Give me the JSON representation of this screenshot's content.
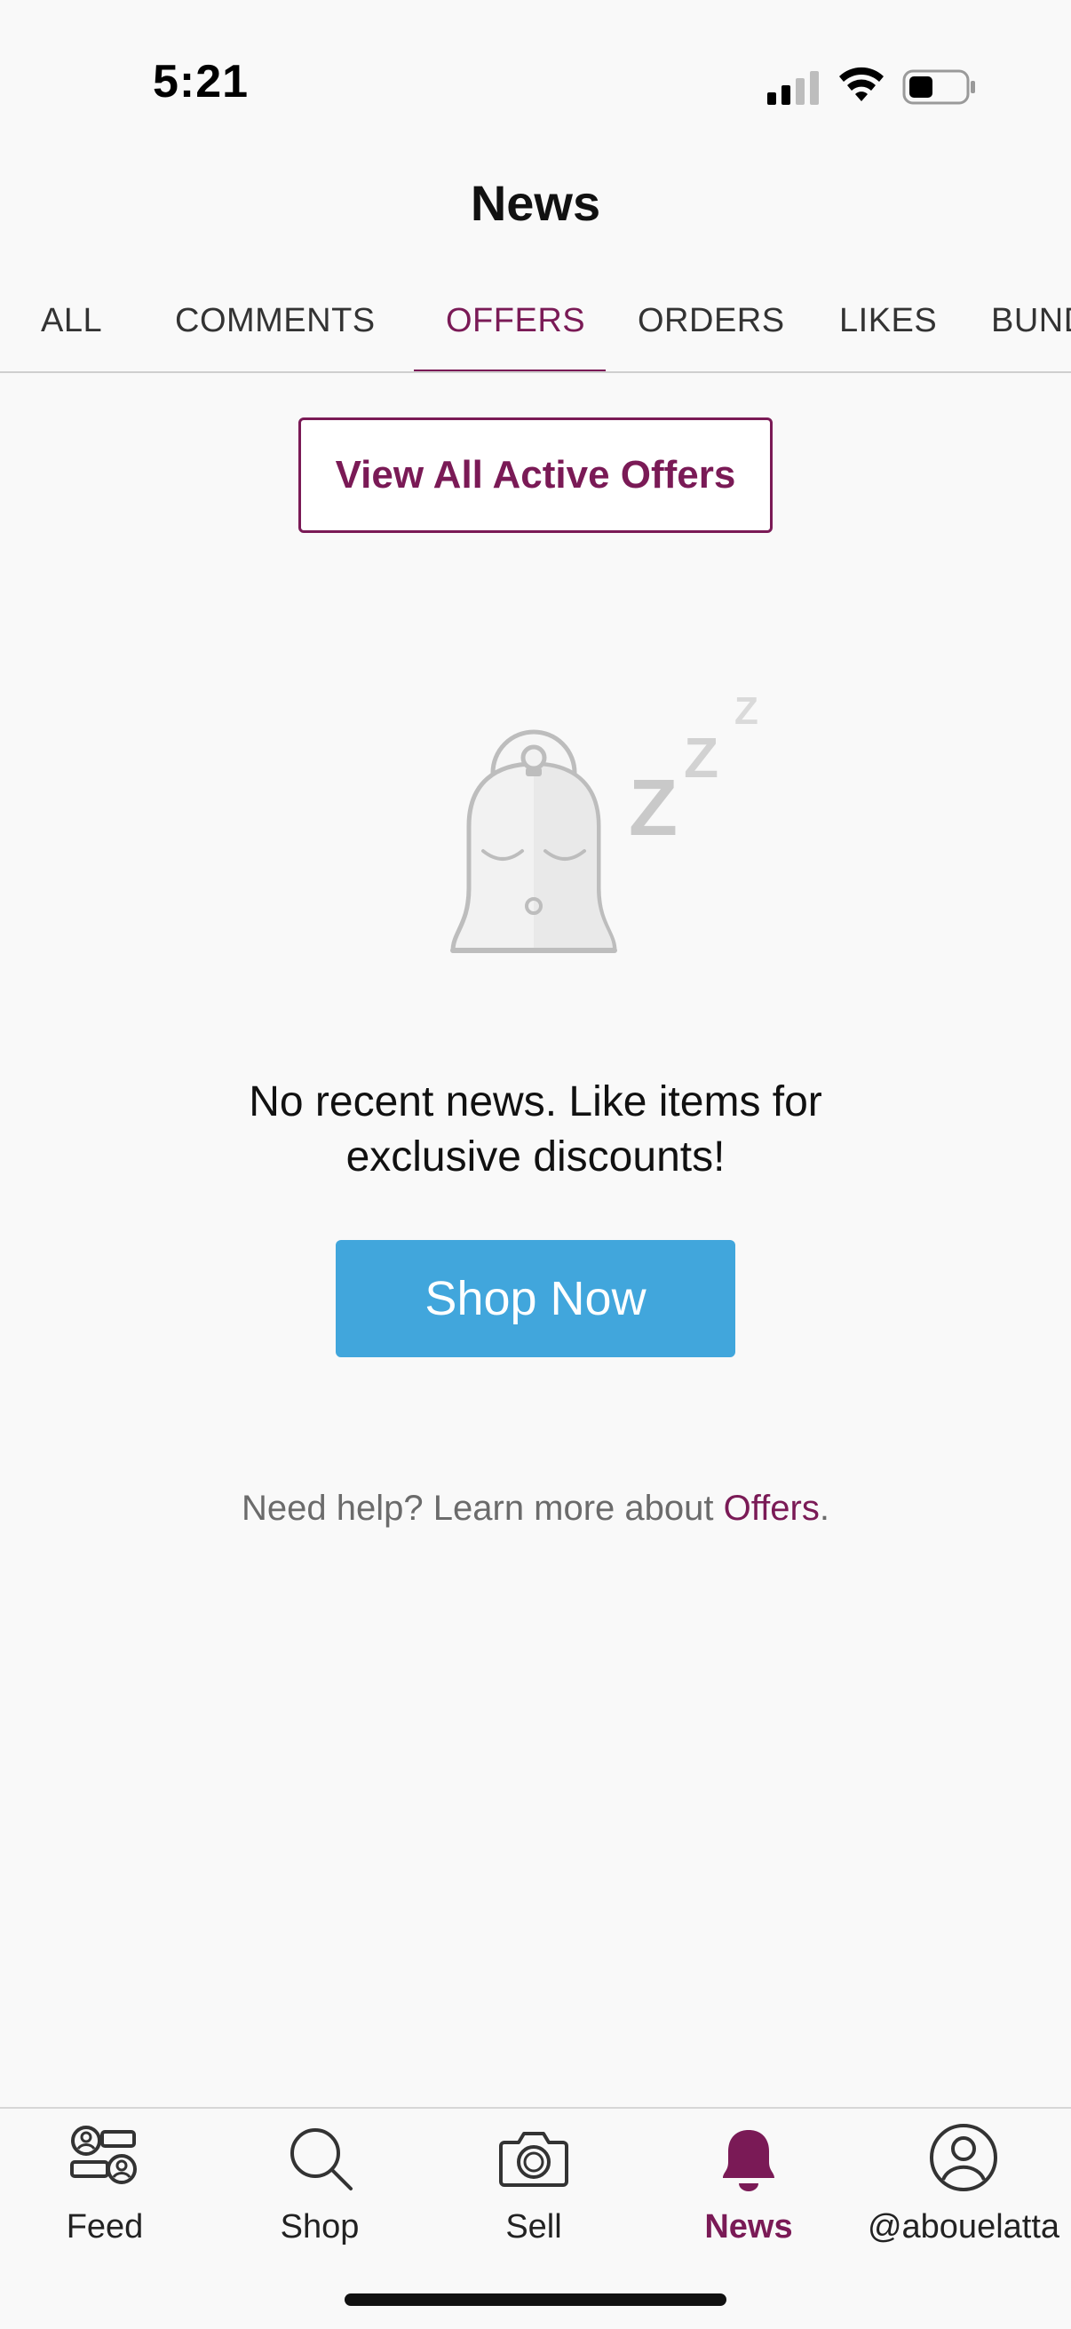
{
  "status_bar": {
    "time": "5:21",
    "icons": [
      "cellular-signal-icon",
      "wifi-icon",
      "battery-icon"
    ]
  },
  "header": {
    "title": "News"
  },
  "tabs": [
    {
      "label": "ALL",
      "active": false
    },
    {
      "label": "COMMENTS",
      "active": false
    },
    {
      "label": "OFFERS",
      "active": true
    },
    {
      "label": "ORDERS",
      "active": false
    },
    {
      "label": "LIKES",
      "active": false
    },
    {
      "label": "BUNDLES",
      "active": false
    }
  ],
  "offers": {
    "view_all_label": "View All Active Offers"
  },
  "empty_state": {
    "illustration": "sleeping-bell-icon",
    "line1": "No recent news. Like items for",
    "line2": "exclusive discounts!",
    "cta_label": "Shop Now",
    "help_prefix": "Need help? Learn more about ",
    "help_link": "Offers",
    "help_suffix": "."
  },
  "bottom_nav": [
    {
      "label": "Feed",
      "icon": "feed-icon",
      "active": false
    },
    {
      "label": "Shop",
      "icon": "search-icon",
      "active": false
    },
    {
      "label": "Sell",
      "icon": "camera-icon",
      "active": false
    },
    {
      "label": "News",
      "icon": "bell-icon",
      "active": true
    },
    {
      "label": "@abouelatta",
      "icon": "profile-icon",
      "active": false
    }
  ],
  "colors": {
    "accent": "#7a1a56",
    "cta": "#41a6dc",
    "background": "#f9f9f9"
  }
}
